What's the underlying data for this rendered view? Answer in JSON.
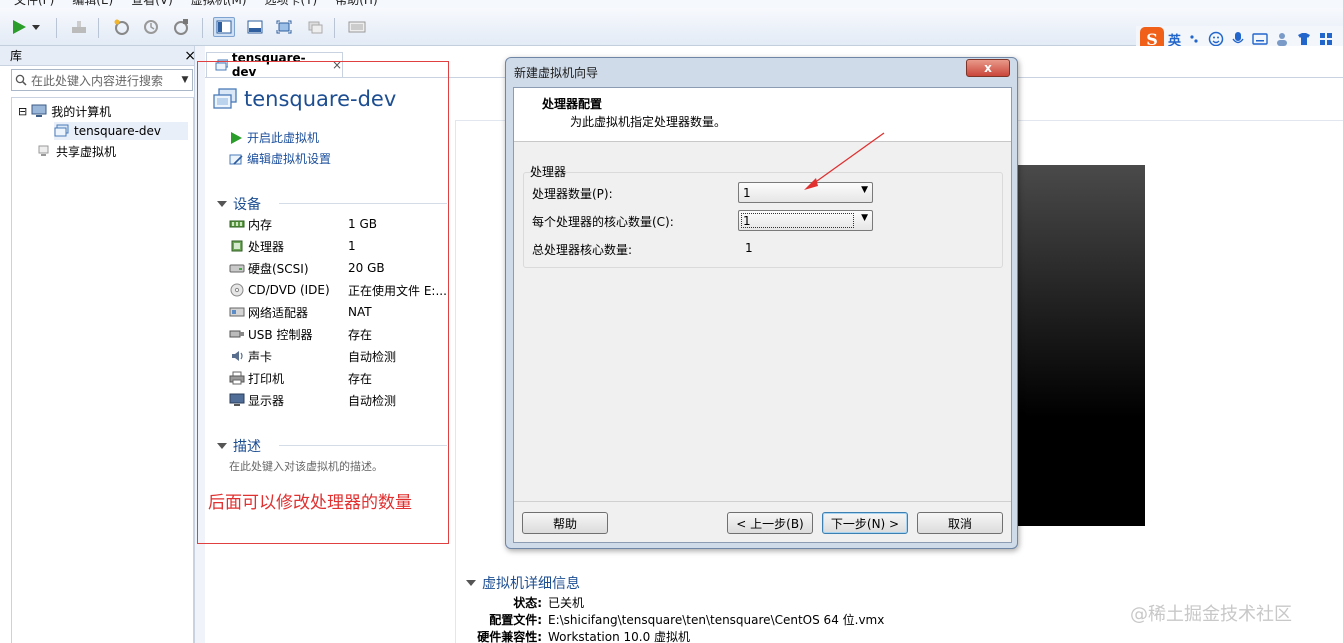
{
  "menu": [
    "文件(F)",
    "编辑(E)",
    "查看(V)",
    "虚拟机(M)",
    "选项卡(T)",
    "帮助(H)"
  ],
  "library": {
    "title": "库",
    "close": "×",
    "search_placeholder": "在此处键入内容进行搜索",
    "tree": [
      {
        "label": "我的计算机"
      },
      {
        "label": "tensquare-dev"
      },
      {
        "label": "共享虚拟机"
      }
    ],
    "expander": "⊟"
  },
  "tab": {
    "label": "tensquare-dev",
    "close": "×"
  },
  "vm": {
    "title": "tensquare-dev",
    "actions": {
      "power_on": "开启此虚拟机",
      "edit": "编辑虚拟机设置"
    },
    "devices_title": "设备",
    "devices": [
      {
        "name": "内存",
        "value": "1 GB",
        "icon": "memory-icon"
      },
      {
        "name": "处理器",
        "value": "1",
        "icon": "cpu-icon"
      },
      {
        "name": "硬盘(SCSI)",
        "value": "20 GB",
        "icon": "disk-icon"
      },
      {
        "name": "CD/DVD (IDE)",
        "value": "正在使用文件 E:...",
        "icon": "cdrom-icon"
      },
      {
        "name": "网络适配器",
        "value": "NAT",
        "icon": "network-icon"
      },
      {
        "name": "USB 控制器",
        "value": "存在",
        "icon": "usb-icon"
      },
      {
        "name": "声卡",
        "value": "自动检测",
        "icon": "sound-icon"
      },
      {
        "name": "打印机",
        "value": "存在",
        "icon": "printer-icon"
      },
      {
        "name": "显示器",
        "value": "自动检测",
        "icon": "display-icon"
      }
    ],
    "desc_title": "描述",
    "desc_hint": "在此处键入对该虚拟机的描述。",
    "details_title": "虚拟机详细信息",
    "details": [
      {
        "key": "状态:",
        "value": "已关机"
      },
      {
        "key": "配置文件:",
        "value": "E:\\shicifang\\tensquare\\ten\\tensquare\\CentOS 64 位.vmx"
      },
      {
        "key": "硬件兼容性:",
        "value": "Workstation 10.0 虚拟机"
      }
    ]
  },
  "annotation": "后面可以修改处理器的数量",
  "dialog": {
    "title": "新建虚拟机向导",
    "close": "x",
    "header_title": "处理器配置",
    "header_subtitle": "为此虚拟机指定处理器数量。",
    "group_title": "处理器",
    "proc_count_label": "处理器数量(P):",
    "proc_count_value": "1",
    "cores_label": "每个处理器的核心数量(C):",
    "cores_value": "1",
    "total_label": "总处理器核心数量:",
    "total_value": "1",
    "buttons": {
      "help": "帮助",
      "back": "< 上一步(B)",
      "next": "下一步(N) >",
      "cancel": "取消"
    }
  },
  "ime": {
    "logo": "S",
    "lang": "英"
  },
  "watermark": "@稀土掘金技术社区",
  "colors": {
    "accent": "#1d4e92",
    "annotation": "#e03030",
    "link": "#1c4f9c"
  }
}
